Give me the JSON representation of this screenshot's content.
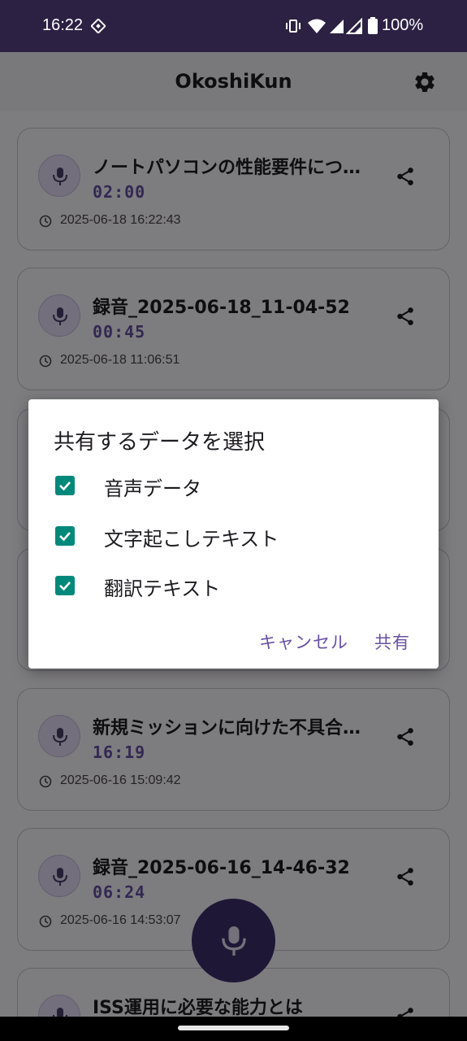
{
  "status_bar": {
    "time": "16:22",
    "battery": "100%"
  },
  "app_bar": {
    "title": "OkoshiKun",
    "settings_icon": "gear-icon"
  },
  "recordings": [
    {
      "title": "ノートパソコンの性能要件につ…",
      "duration": "02:00",
      "datetime": "2025-06-18 16:22:43"
    },
    {
      "title": "録音_2025-06-18_11-04-52",
      "duration": "00:45",
      "datetime": "2025-06-18 11:06:51"
    },
    {
      "title": "新規ミッションに向けた不具合…",
      "duration": "16:19",
      "datetime": "2025-06-16 15:09:42"
    },
    {
      "title": "録音_2025-06-16_14-46-32",
      "duration": "06:24",
      "datetime": "2025-06-16 14:53:07"
    },
    {
      "title": "ISS運用に必要な能力とは"
    }
  ],
  "dialog": {
    "title": "共有するデータを選択",
    "options": [
      {
        "label": "音声データ",
        "checked": true
      },
      {
        "label": "文字起こしテキスト",
        "checked": true
      },
      {
        "label": "翻訳テキスト",
        "checked": true
      }
    ],
    "cancel_label": "キャンセル",
    "confirm_label": "共有"
  },
  "colors": {
    "accent": "#6750a4",
    "checkbox": "#00897b",
    "status_bar": "#2c2143",
    "fab": "#3c2f6d"
  }
}
